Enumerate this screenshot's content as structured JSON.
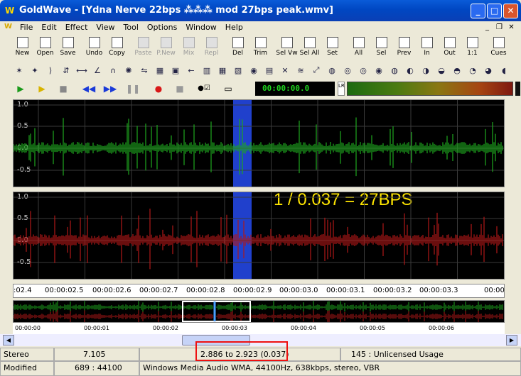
{
  "window": {
    "title": "GoldWave - [Ydna Nerve 22bps ⁂⁂⁂ mod 27bps peak.wmv]",
    "app_icon": "W",
    "title_bar_color": "#0047c2"
  },
  "menubar": {
    "items": [
      "File",
      "Edit",
      "Effect",
      "View",
      "Tool",
      "Options",
      "Window",
      "Help"
    ]
  },
  "toolbar": {
    "buttons": [
      {
        "label": "New",
        "icon": "new-file-icon",
        "enabled": true
      },
      {
        "label": "Open",
        "icon": "open-folder-icon",
        "enabled": true
      },
      {
        "label": "Save",
        "icon": "save-disk-icon",
        "enabled": true
      },
      {
        "label": "Undo",
        "icon": "undo-icon",
        "enabled": true
      },
      {
        "label": "Copy",
        "icon": "copy-icon",
        "enabled": true
      },
      {
        "label": "Paste",
        "icon": "paste-icon",
        "enabled": false
      },
      {
        "label": "P.New",
        "icon": "paste-new-icon",
        "enabled": false
      },
      {
        "label": "Mix",
        "icon": "mix-icon",
        "enabled": false
      },
      {
        "label": "Repl",
        "icon": "replace-icon",
        "enabled": false
      },
      {
        "label": "Del",
        "icon": "delete-icon",
        "enabled": true
      },
      {
        "label": "Trim",
        "icon": "trim-icon",
        "enabled": true
      },
      {
        "label": "Sel Vw",
        "icon": "select-view-icon",
        "enabled": true
      },
      {
        "label": "Sel All",
        "icon": "select-all-icon",
        "enabled": true
      },
      {
        "label": "Set",
        "icon": "set-icon",
        "enabled": true
      },
      {
        "label": "All",
        "icon": "zoom-all-icon",
        "enabled": true
      },
      {
        "label": "Sel",
        "icon": "zoom-selection-icon",
        "enabled": true
      },
      {
        "label": "Prev",
        "icon": "zoom-previous-icon",
        "enabled": true
      },
      {
        "label": "In",
        "icon": "zoom-in-icon",
        "enabled": true
      },
      {
        "label": "Out",
        "icon": "zoom-out-icon",
        "enabled": true
      },
      {
        "label": "1:1",
        "icon": "zoom-1to1-icon",
        "enabled": true
      },
      {
        "label": "Cues",
        "icon": "cues-icon",
        "enabled": true
      }
    ]
  },
  "effects_toolbar_count": 38,
  "transport": {
    "time": "00:00:00.0",
    "lr_label": "LR"
  },
  "channels": {
    "y_labels": [
      "1.0",
      "0.5",
      "0.0",
      "-0.5"
    ],
    "left_color": "#1ea81e",
    "right_color": "#b01818"
  },
  "annotation": "1 / 0.037 = 27BPS",
  "timeline": {
    "labels": [
      ":02.4",
      "00:00:02.5",
      "00:00:02.6",
      "00:00:02.7",
      "00:00:02.8",
      "00:00:02.9",
      "00:00:03.0",
      "00:00:03.1",
      "00:00:03.2",
      "00:00:03.3",
      "00:00"
    ]
  },
  "overview_timeline": {
    "labels": [
      "00:00:00",
      "00:00:01",
      "00:00:02",
      "00:00:03",
      "00:00:04",
      "00:00:05",
      "00:00:06"
    ]
  },
  "status": {
    "channels": "Stereo",
    "duration": "7.105",
    "selection": "2.886 to 2.923 (0.037)",
    "license": "145 : Unlicensed Usage",
    "state": "Modified",
    "rate_info": "689 : 44100",
    "format": "Windows Media Audio WMA, 44100Hz, 638kbps, stereo, VBR"
  }
}
